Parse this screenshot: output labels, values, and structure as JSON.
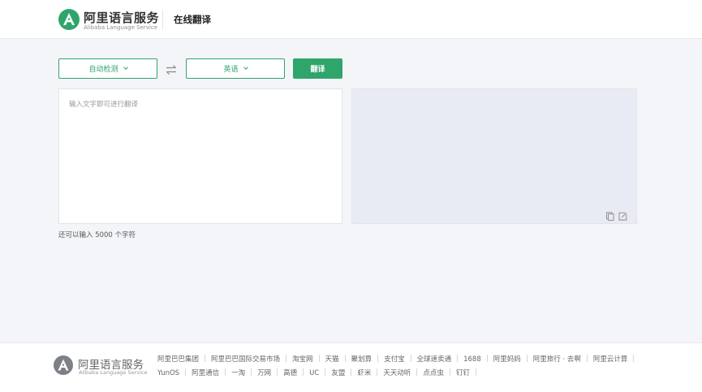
{
  "header": {
    "brand_cn": "阿里语言服务",
    "brand_en": "Alibaba Language Service",
    "page_title": "在线翻译",
    "brand_color": "#2fa56b"
  },
  "controls": {
    "source_lang": "自动检测",
    "target_lang": "英语",
    "translate_label": "翻译",
    "swap_icon": "swap-arrows-icon"
  },
  "editor": {
    "placeholder": "输入文字即可进行翻译",
    "value": "",
    "char_remaining": "还可以输入 5000 个字符"
  },
  "result": {
    "copy_icon": "copy-icon",
    "edit_icon": "edit-icon"
  },
  "footer": {
    "brand_cn": "阿里语言服务",
    "brand_en": "Alibaba Language Service",
    "links": [
      "阿里巴巴集团",
      "阿里巴巴国际交易市场",
      "淘宝网",
      "天猫",
      "聚划算",
      "支付宝",
      "全球速卖通",
      "1688",
      "阿里妈妈",
      "阿里旅行 · 去啊",
      "阿里云计算",
      "YunOS",
      "阿里通信",
      "一淘",
      "万网",
      "高德",
      "UC",
      "友盟",
      "虾米",
      "天天动听",
      "点点虫",
      "钉钉"
    ]
  }
}
